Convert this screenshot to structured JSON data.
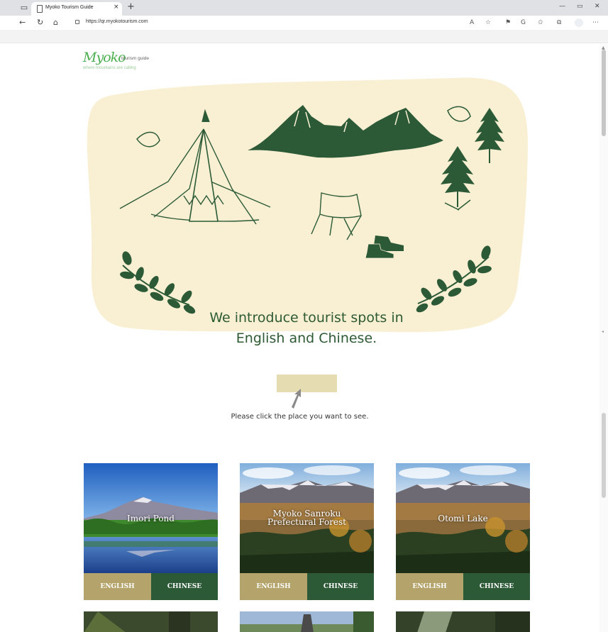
{
  "browser": {
    "tab_title": "Myoko Tourism Guide",
    "url": "https://qr.myokotourism.com",
    "close_tab": "×",
    "new_tab": "+",
    "minimize": "—",
    "restore": "▭",
    "close_window": "✕"
  },
  "logo": {
    "script": "Myoko",
    "tagline": "tourism guide",
    "motto": "where mountains are calling"
  },
  "hero": {
    "line1": "We introduce tourist spots in",
    "line2": "English and Chinese."
  },
  "instruction": "Please click the place you want to see.",
  "colors": {
    "hero_bg": "#f9f0d4",
    "forest_green": "#2c5a36",
    "english_btn": "#b4a36a",
    "chinese_btn": "#2c5a36",
    "click_box": "#e6dcb2"
  },
  "cards": [
    {
      "title_lines": [
        "Imori Pond"
      ],
      "english": "ENGLISH",
      "chinese": "CHINESE"
    },
    {
      "title_lines": [
        "Myoko Sanroku",
        "Prefectural Forest"
      ],
      "english": "ENGLISH",
      "chinese": "CHINESE"
    },
    {
      "title_lines": [
        "Otomi Lake"
      ],
      "english": "ENGLISH",
      "chinese": "CHINESE"
    }
  ]
}
